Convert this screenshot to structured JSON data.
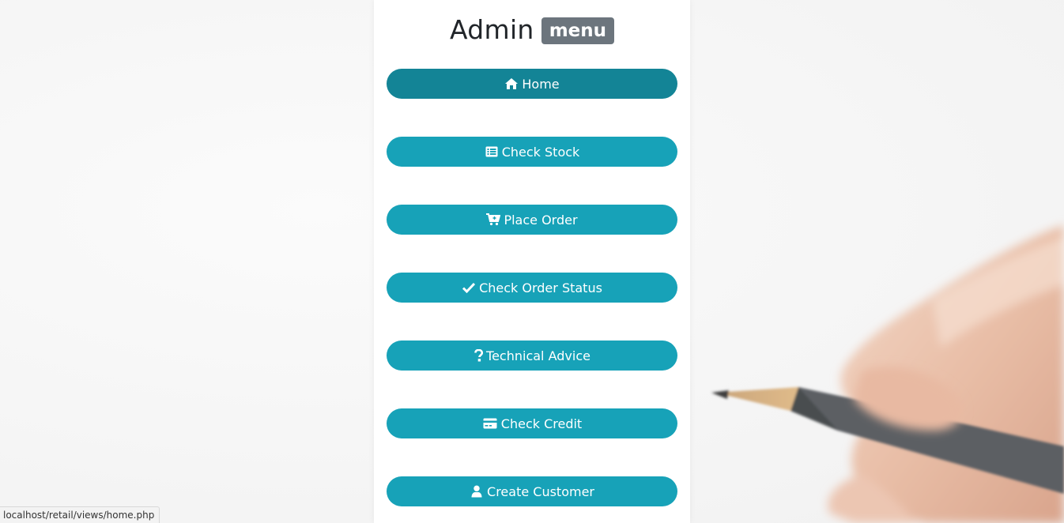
{
  "header": {
    "title": "Admin",
    "badge": "menu"
  },
  "menu": {
    "items": [
      {
        "label": "Home",
        "icon": "home-icon",
        "active": true
      },
      {
        "label": "Check Stock",
        "icon": "list-alt-icon",
        "active": false
      },
      {
        "label": "Place Order",
        "icon": "cart-plus-icon",
        "active": false
      },
      {
        "label": "Check Order Status",
        "icon": "check-icon",
        "active": false
      },
      {
        "label": "Technical Advice",
        "icon": "question-icon",
        "active": false
      },
      {
        "label": "Check Credit",
        "icon": "credit-card-icon",
        "active": false
      },
      {
        "label": "Create Customer",
        "icon": "user-icon",
        "active": false
      }
    ]
  },
  "status_bar": {
    "url": "localhost/retail/views/home.php"
  },
  "colors": {
    "button": "#17a2b8",
    "button_active": "#138496",
    "badge": "#6c757d",
    "title": "#212529"
  }
}
